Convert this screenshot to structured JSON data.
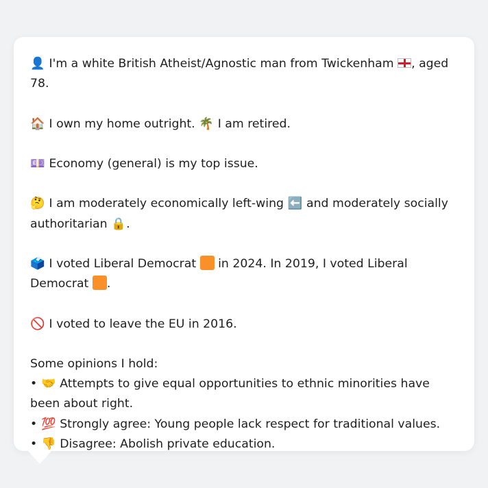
{
  "colors": {
    "page_background": "#f1f2f4",
    "bubble_background": "#ffffff",
    "text": "#1f1f1f",
    "flag_red": "#d0202a",
    "party_orange": "#f9902a"
  },
  "profile": {
    "identity": {
      "icon": "bust-in-silhouette-icon",
      "glyph": "👤",
      "text_before_flag": "I'm a white British Atheist/Agnostic man from Twickenham",
      "flag_icon": "england-flag-icon",
      "text_after_flag": ", aged 78."
    },
    "housing": {
      "home_icon": "house-icon",
      "home_glyph": "🏠",
      "home_text": "I own my home outright.",
      "retired_icon": "palm-tree-icon",
      "retired_glyph": "🌴",
      "retired_text": "I am retired."
    },
    "top_issue": {
      "icon": "money-notes-icon",
      "glyph": "💷",
      "text": "Economy (general) is my top issue."
    },
    "ideology": {
      "icon": "thinking-face-icon",
      "glyph": "🤔",
      "text_1": "I am moderately economically left-wing",
      "left_arrow_icon": "left-arrow-icon",
      "left_arrow_glyph": "⬅️",
      "text_2": "and moderately socially authoritarian",
      "lock_icon": "lock-icon",
      "lock_glyph": "🔒",
      "text_3": "."
    },
    "votes": {
      "icon": "ballot-box-icon",
      "glyph": "🗳️",
      "text_1": "I voted Liberal Democrat",
      "party_icon_1": "orange-square-icon",
      "text_2": "in 2024. In 2019, I voted Liberal Democrat",
      "party_icon_2": "orange-square-icon",
      "text_3": "."
    },
    "brexit": {
      "icon": "prohibited-icon",
      "glyph": "🚫",
      "text": "I voted to leave the EU in 2016."
    },
    "opinions": {
      "heading": "Some opinions I hold:",
      "bullet": "•",
      "items": [
        {
          "icon": "handshake-icon",
          "glyph": "🤝",
          "text": "Attempts to give equal opportunities to ethnic minorities have been about right."
        },
        {
          "icon": "hundred-points-icon",
          "glyph": "💯",
          "text": "Strongly agree: Young people lack respect for traditional values."
        },
        {
          "icon": "thumbs-down-icon",
          "glyph": "👎",
          "text": "Disagree: Abolish private education."
        }
      ]
    }
  }
}
